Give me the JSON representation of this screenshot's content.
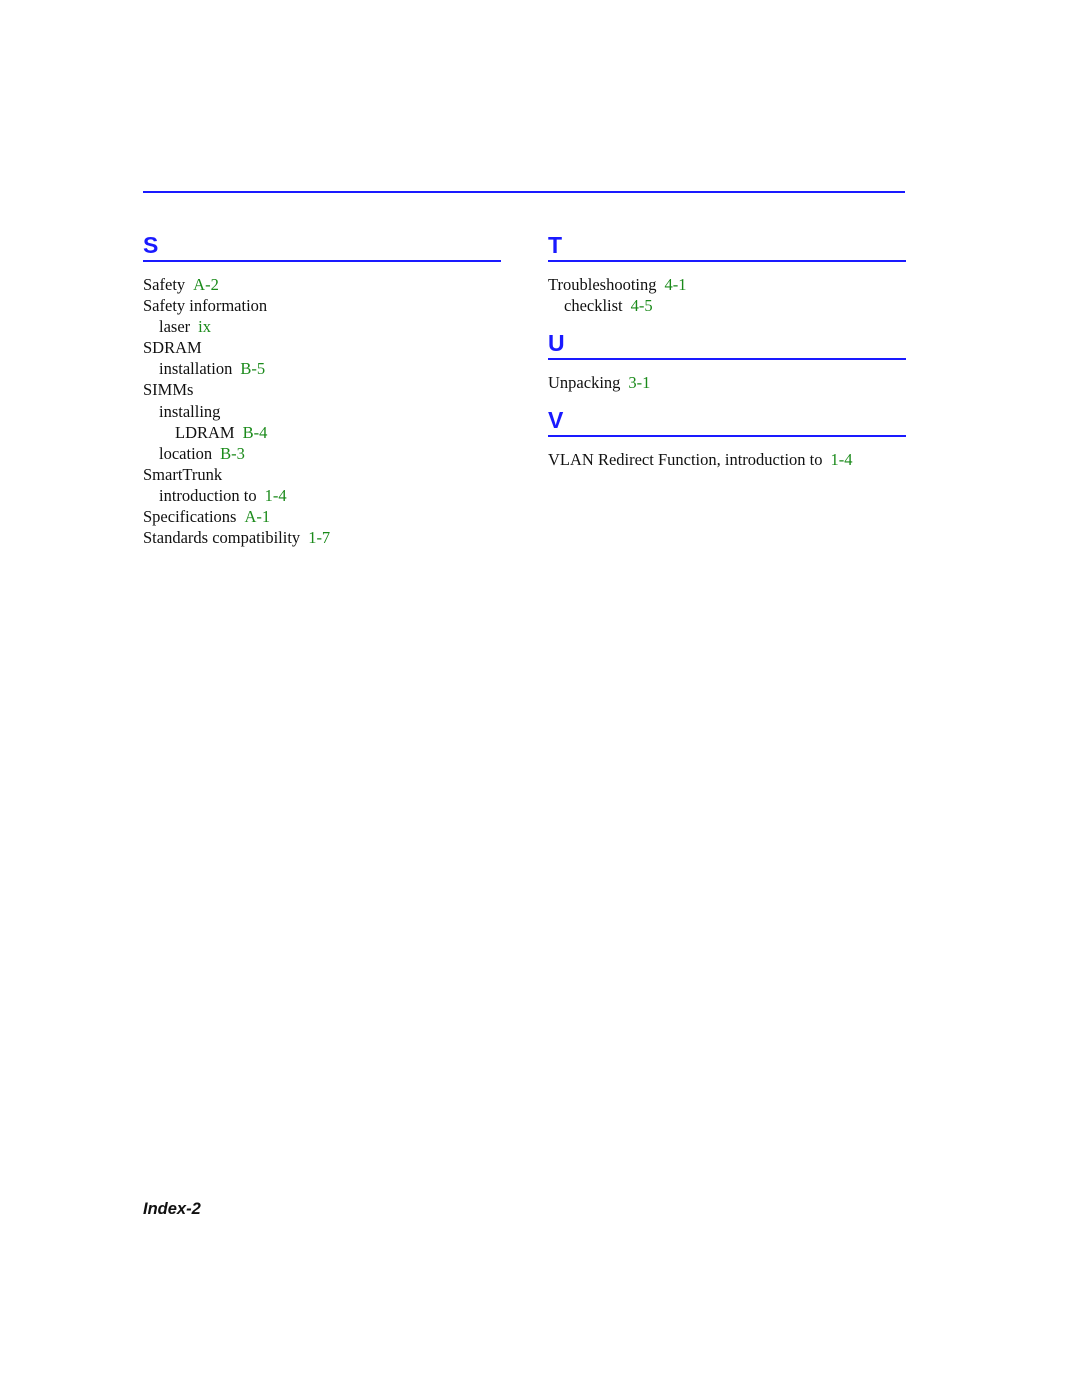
{
  "sections": {
    "S": {
      "letter": "S",
      "entries": [
        {
          "term": "Safety",
          "page": "A-2"
        },
        {
          "term": "Safety information",
          "page": null
        },
        {
          "term": "laser",
          "page": "ix"
        },
        {
          "term": "SDRAM",
          "page": null
        },
        {
          "term": "installation",
          "page": "B-5"
        },
        {
          "term": "SIMMs",
          "page": null
        },
        {
          "term": "installing",
          "page": null
        },
        {
          "term": "LDRAM",
          "page": "B-4"
        },
        {
          "term": "location",
          "page": "B-3"
        },
        {
          "term": "SmartTrunk",
          "page": null
        },
        {
          "term": "introduction to",
          "page": "1-4"
        },
        {
          "term": "Specifications",
          "page": "A-1"
        },
        {
          "term": "Standards compatibility",
          "page": "1-7"
        }
      ]
    },
    "T": {
      "letter": "T",
      "entries": [
        {
          "term": "Troubleshooting",
          "page": "4-1"
        },
        {
          "term": "checklist",
          "page": "4-5"
        }
      ]
    },
    "U": {
      "letter": "U",
      "entries": [
        {
          "term": "Unpacking",
          "page": "3-1"
        }
      ]
    },
    "V": {
      "letter": "V",
      "entries": [
        {
          "term": "VLAN Redirect Function, introduction to",
          "page": "1-4"
        }
      ]
    }
  },
  "footer": {
    "page_label": "Index-2"
  },
  "colors": {
    "heading": "#1a1aff",
    "page_ref": "#1a8a1a",
    "text": "#111111"
  }
}
